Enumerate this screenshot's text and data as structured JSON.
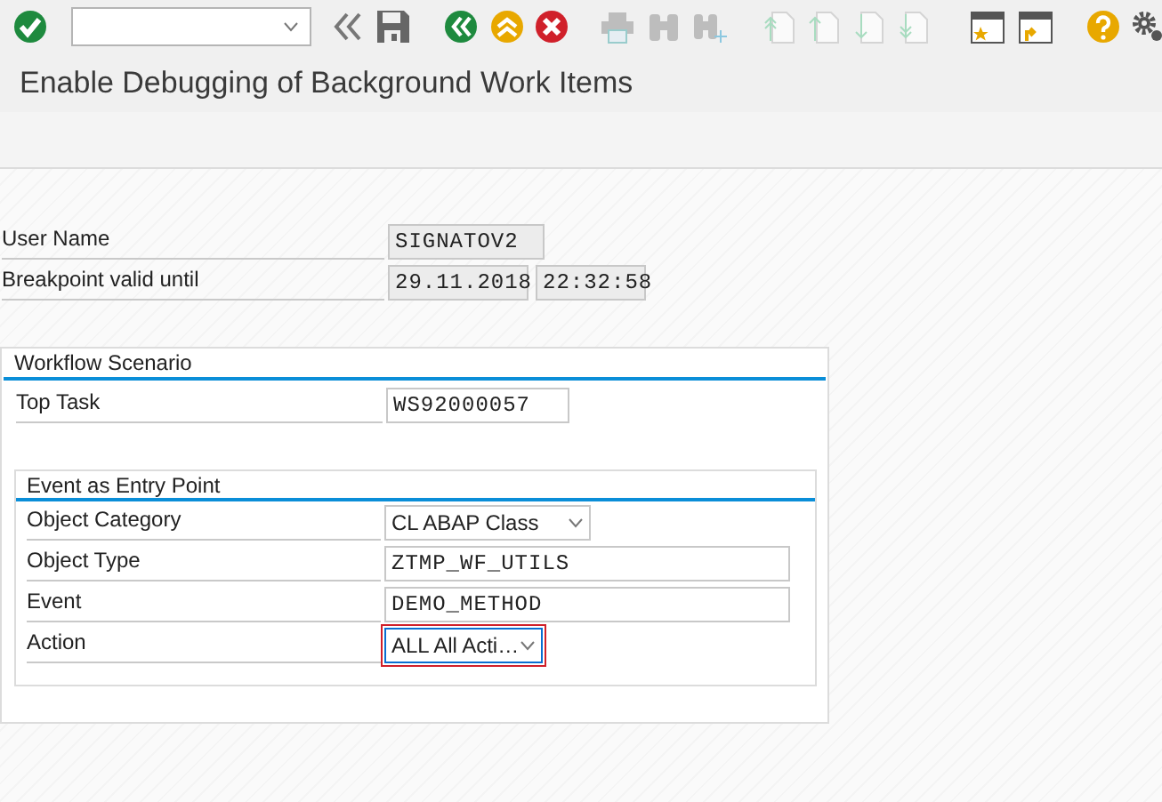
{
  "toolbar": {
    "buttons": [
      {
        "kind": "enter",
        "disabled": false
      },
      {
        "kind": "command",
        "disabled": false
      },
      {
        "kind": "collapse",
        "disabled": false
      },
      {
        "kind": "save",
        "disabled": false
      },
      {
        "kind": "back",
        "disabled": false
      },
      {
        "kind": "exit",
        "disabled": false
      },
      {
        "kind": "cancel",
        "disabled": false
      },
      {
        "kind": "print",
        "disabled": true
      },
      {
        "kind": "find",
        "disabled": true
      },
      {
        "kind": "find_next",
        "disabled": true
      },
      {
        "kind": "first_page",
        "disabled": true
      },
      {
        "kind": "previous_page",
        "disabled": true
      },
      {
        "kind": "next_page",
        "disabled": true
      },
      {
        "kind": "last_page",
        "disabled": true
      },
      {
        "kind": "new_session",
        "disabled": false
      },
      {
        "kind": "shortcut",
        "disabled": false
      },
      {
        "kind": "help",
        "disabled": false
      },
      {
        "kind": "settings",
        "disabled": false
      }
    ]
  },
  "window": {
    "title": "Enable Debugging of Background Work Items"
  },
  "header_fields": [
    {
      "label": "User Name",
      "kind": "display",
      "values": [
        "SIGNATOV2"
      ]
    },
    {
      "label": "Breakpoint valid until",
      "kind": "display",
      "values": [
        "29.11.2018",
        "22:32:58"
      ]
    }
  ],
  "workflow_scenario": {
    "title": "Workflow Scenario",
    "fields": [
      {
        "label": "Top Task",
        "kind": "input",
        "value": "WS92000057"
      }
    ],
    "event_group": {
      "title": "Event as Entry Point",
      "fields": [
        {
          "label": "Object Category",
          "kind": "dropdown",
          "value": "CL ABAP Class",
          "focused": false
        },
        {
          "label": "Object Type",
          "kind": "input",
          "value": "ZTMP_WF_UTILS",
          "focused": false
        },
        {
          "label": "Event",
          "kind": "input",
          "value": "DEMO_METHOD",
          "focused": false
        },
        {
          "label": "Action",
          "kind": "dropdown",
          "value": "ALL All Acti…",
          "focused": true
        }
      ]
    }
  }
}
